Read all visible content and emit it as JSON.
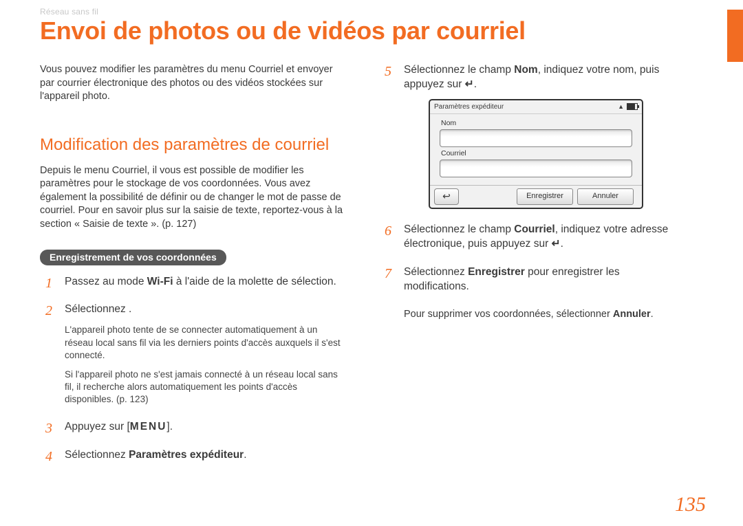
{
  "breadcrumb": "Réseau sans fil",
  "title": "Envoi de photos ou de vidéos par courriel",
  "intro": "Vous pouvez modifier les paramètres du menu Courriel et envoyer par courrier électronique des photos ou des vidéos stockées sur l'appareil photo.",
  "section_heading": "Modification des paramètres de courriel",
  "section_body": "Depuis le menu Courriel, il vous est possible de modifier les paramètres pour le stockage de vos coordonnées. Vous avez également la possibilité de définir ou de changer le mot de passe de courriel. Pour en savoir plus sur la saisie de texte, reportez-vous à la section « Saisie de texte ». (p. 127)",
  "pill": "Enregistrement de vos coordonnées",
  "steps_left": {
    "s1_a": "Passez au mode ",
    "s1_wifi": "Wi-Fi",
    "s1_b": " à l'aide de la molette de sélection.",
    "s2": "Sélectionnez       .",
    "s2_note_a": "L'appareil photo tente de se connecter automatiquement à un réseau local sans fil via les derniers points d'accès auxquels il s'est connecté.",
    "s2_note_b": "Si l'appareil photo ne s'est jamais connecté à un réseau local sans fil, il recherche alors automatiquement les points d'accès disponibles. (p. 123)",
    "s3_a": "Appuyez sur [",
    "s3_menu": "MENU",
    "s3_b": "].",
    "s4_a": "Sélectionnez ",
    "s4_b": "Paramètres expéditeur",
    "s4_c": "."
  },
  "steps_right": {
    "s5_a": "Sélectionnez le champ ",
    "s5_b": "Nom",
    "s5_c": ", indiquez votre nom, puis appuyez sur ",
    "s5_d": ".",
    "s6_a": "Sélectionnez le champ ",
    "s6_b": "Courriel",
    "s6_c": ", indiquez votre adresse électronique, puis appuyez sur ",
    "s6_d": ".",
    "s7_a": "Sélectionnez ",
    "s7_b": "Enregistrer",
    "s7_c": " pour enregistrer les modifications.",
    "delete_a": "Pour supprimer vos coordonnées, sélectionner ",
    "delete_b": "Annuler",
    "delete_c": "."
  },
  "device": {
    "header": "Paramètres expéditeur",
    "field1": "Nom",
    "field2": "Courriel",
    "save": "Enregistrer",
    "cancel": "Annuler"
  },
  "page_number": "135",
  "enter_glyph": "↵"
}
